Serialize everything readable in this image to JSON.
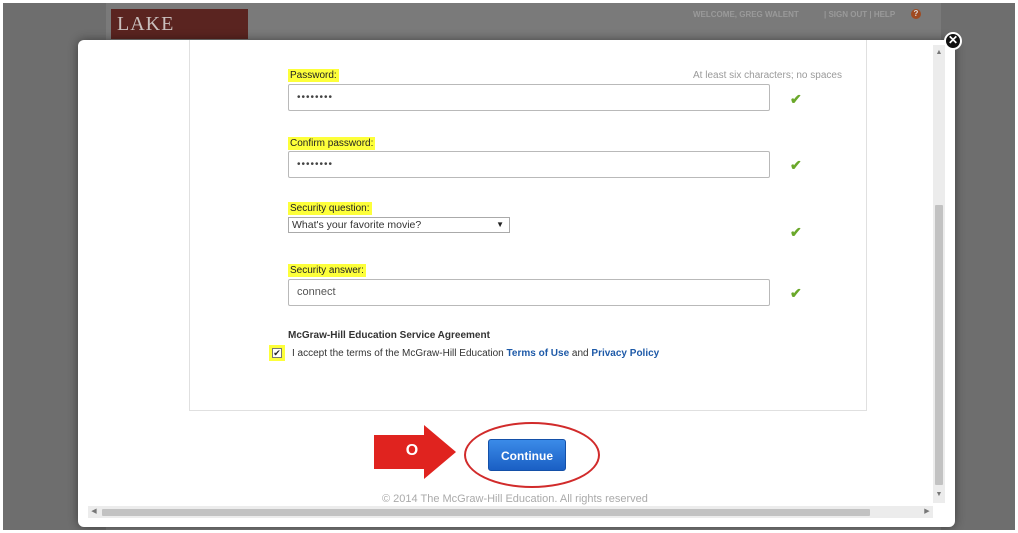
{
  "background": {
    "logo_text": "LAKE VALLEY",
    "welcome_text": "WELCOME, GREG WALENT",
    "links_text": "| SIGN OUT | HELP",
    "help_icon": "?"
  },
  "modal": {
    "close_icon": "✕",
    "password": {
      "label": "Password:",
      "hint": "At least six characters; no spaces",
      "value": "••••••••"
    },
    "confirm_password": {
      "label": "Confirm password:",
      "value": "••••••••"
    },
    "security_question": {
      "label": "Security question:",
      "selected": "What's your favorite movie?"
    },
    "security_answer": {
      "label": "Security answer:",
      "value": "connect"
    },
    "valid_mark": "✔",
    "agreement": {
      "title": "McGraw-Hill Education Service Agreement",
      "checked": true,
      "text_before": "I accept the terms of the McGraw-Hill Education ",
      "terms_link": "Terms of Use",
      "text_and": " and ",
      "privacy_link": "Privacy Policy"
    },
    "continue_label": "Continue",
    "annotation_label": "O",
    "footer": "© 2014 The McGraw-Hill Education. All rights reserved"
  },
  "colors": {
    "highlight": "#fdff3a",
    "accent": "#1a5fc4",
    "annotation": "#d12b2b",
    "valid": "#6aa82a"
  }
}
